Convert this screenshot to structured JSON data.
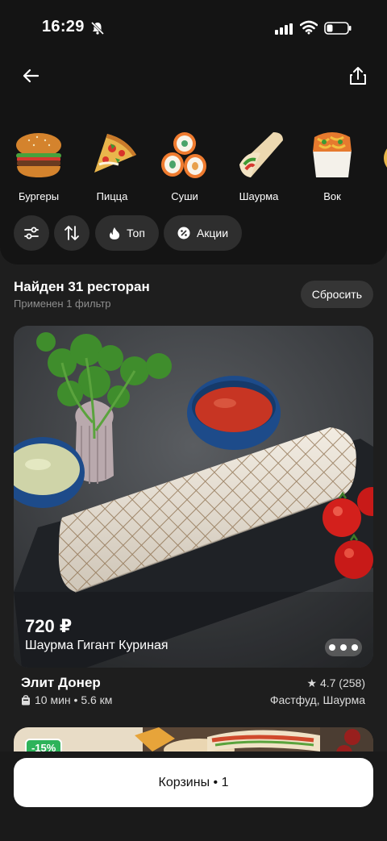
{
  "status_bar": {
    "time": "16:29"
  },
  "categories": [
    {
      "label": "Бургеры",
      "icon": "burger-icon"
    },
    {
      "label": "Пицца",
      "icon": "pizza-icon"
    },
    {
      "label": "Суши",
      "icon": "sushi-icon"
    },
    {
      "label": "Шаурма",
      "icon": "shawarma-icon"
    },
    {
      "label": "Вок",
      "icon": "wok-icon"
    }
  ],
  "filters": {
    "settings_icon": "sliders-icon",
    "sort_icon": "sort-arrows-icon",
    "top_label": "Топ",
    "promo_label": "Акции"
  },
  "results": {
    "title": "Найден 31 ресторан",
    "subtitle": "Применен 1 фильтр",
    "reset_label": "Сбросить"
  },
  "card": {
    "price": "720 ₽",
    "dish_name": "Шаурма Гигант Куриная",
    "restaurant_name": "Элит Донер",
    "rating": "★ 4.7 (258)",
    "delivery": "10 мин • 5.6 км",
    "cuisine": "Фастфуд, Шаурма"
  },
  "next_card": {
    "discount": "-15%"
  },
  "cart": {
    "label": "Корзины • 1"
  },
  "colors": {
    "background": "#141414",
    "chip": "#2e2e2e",
    "discount": "#2db35a"
  }
}
